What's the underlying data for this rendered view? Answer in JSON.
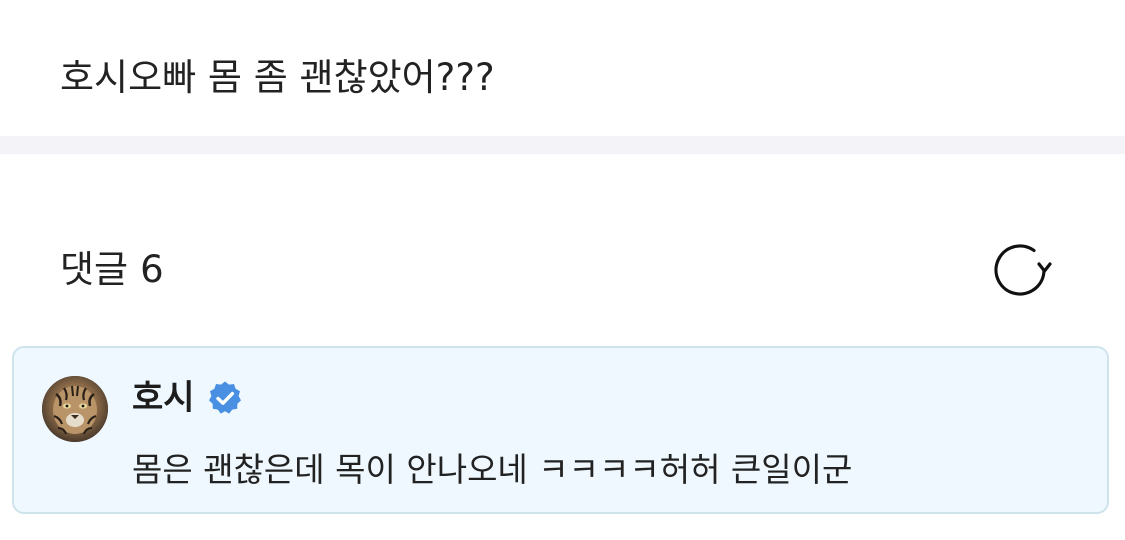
{
  "post": {
    "text": "호시오빠 몸 좀 괜찮았어???"
  },
  "comments_section": {
    "title": "댓글",
    "count": "6",
    "refresh_icon": "refresh-icon"
  },
  "comments": [
    {
      "author": "호시",
      "verified": true,
      "verified_icon": "verified-badge-icon",
      "avatar_icon": "tiger-avatar",
      "text": "몸은 괜찮은데 목이 안나오네 ㅋㅋㅋㅋ허허 큰일이군"
    }
  ],
  "colors": {
    "card_background": "#eef8fe",
    "card_border": "#cfe3ec",
    "verified_badge": "#4a90e2",
    "divider": "#f4f4f8"
  }
}
